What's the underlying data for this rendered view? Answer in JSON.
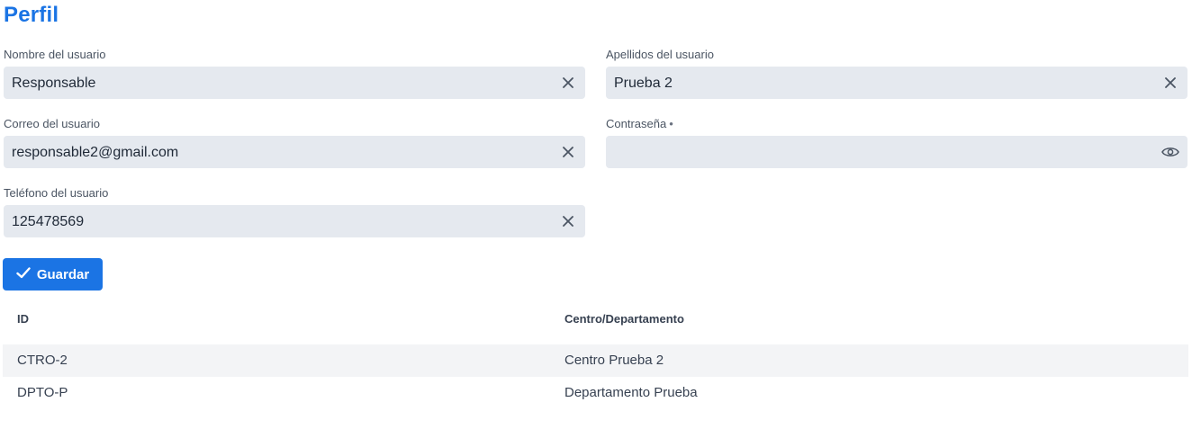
{
  "page": {
    "title": "Perfil"
  },
  "form": {
    "nombre": {
      "label": "Nombre del usuario",
      "value": "Responsable"
    },
    "apellidos": {
      "label": "Apellidos del usuario",
      "value": "Prueba 2"
    },
    "correo": {
      "label": "Correo del usuario",
      "value": "responsable2@gmail.com"
    },
    "password": {
      "label": "Contraseña",
      "required_mark": "•",
      "value": ""
    },
    "telefono": {
      "label": "Teléfono del usuario",
      "value": "125478569"
    },
    "save_label": "Guardar"
  },
  "table": {
    "headers": [
      "ID",
      "Centro/Departamento"
    ],
    "rows": [
      [
        "CTRO-2",
        "Centro Prueba 2"
      ],
      [
        "DPTO-P",
        "Departamento Prueba"
      ]
    ]
  },
  "icons": {
    "clear": "close-icon",
    "show_password": "eye-icon",
    "save": "check-icon"
  },
  "colors": {
    "accent": "#1b74e4",
    "field_bg": "#e5e9ef",
    "row_alt": "#f3f4f6"
  }
}
